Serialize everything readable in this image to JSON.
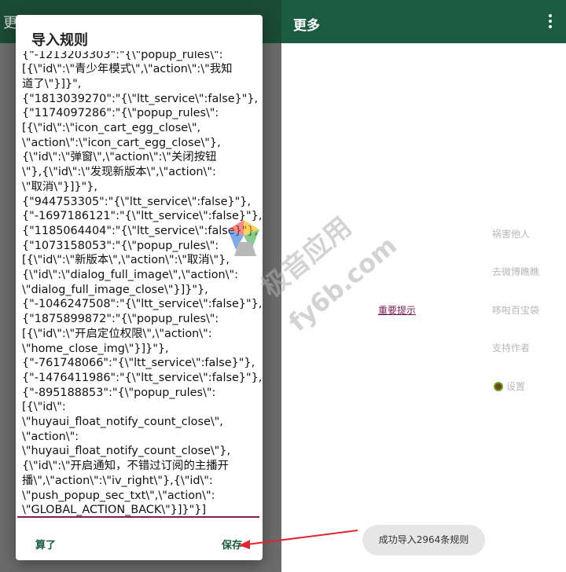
{
  "left_screen": {
    "title_ghost": "更"
  },
  "dialog": {
    "title": "导入规则",
    "rules_text": [
      "{\"-1213203303\":\"{\\\"popup_rules\\\":",
      "[{\\\"id\\\":\\\"青少年模式\\\",\\\"action\\\":\\\"我知",
      "道了\\\"}]}\",",
      "{\"1813039270\":\"{\\\"ltt_service\\\":false}\"},",
      "{\"1174097286\":\"{\\\"popup_rules\\\":",
      "[{\\\"id\\\":\\\"icon_cart_egg_close\\\",",
      "\\\"action\\\":\\\"icon_cart_egg_close\\\"},",
      "{\\\"id\\\":\\\"弹窗\\\",\\\"action\\\":\\\"关闭按钮",
      "\\\"},{\\\"id\\\":\\\"发现新版本\\\",\\\"action\\\":",
      "\\\"取消\\\"}]}\"},",
      "{\"944753305\":\"{\\\"ltt_service\\\":false}\"},",
      "{\"-1697186121\":\"{\\\"ltt_service\\\":false}\"},",
      "{\"1185064404\":\"{\\\"ltt_service\\\":false}\"},",
      "{\"1073158053\":\"{\\\"popup_rules\\\":",
      "[{\\\"id\\\":\\\"新版本\\\",\\\"action\\\":\\\"取消\\\"},",
      "{\\\"id\\\":\\\"dialog_full_image\\\",\\\"action\\\":",
      "\\\"dialog_full_image_close\\\"}]}\"},",
      "{\"-1046247508\":\"{\\\"ltt_service\\\":false}\"},",
      "{\"1875899872\":\"{\\\"popup_rules\\\":",
      "[{\\\"id\\\":\\\"开启定位权限\\\",\\\"action\\\":",
      "\\\"home_close_img\\\"}]}\"},",
      "{\"-761748066\":\"{\\\"ltt_service\\\":false}\"},",
      "{\"-1476411986\":\"{\\\"ltt_service\\\":false}\"},",
      "{\"-895188853\":\"{\\\"popup_rules\\\":",
      "[{\\\"id\\\":",
      "\\\"huyaui_float_notify_count_close\\\",",
      "\\\"action\\\":",
      "\\\"huyaui_float_notify_count_close\\\"},",
      "{\\\"id\\\":\\\"开启通知，不错过订阅的主播开",
      "播\\\",\\\"action\\\":\\\"iv_right\\\"},{\\\"id\\\":",
      "\\\"push_popup_sec_txt\\\",\\\"action\\\":",
      "\\\"GLOBAL_ACTION_BACK\\\"}]}\"}]"
    ],
    "cancel_label": "算了",
    "save_label": "保存"
  },
  "right_screen": {
    "title": "更多",
    "menu_items": [
      "祸害他人",
      "去微博瞧瞧",
      "哆啦百宝袋",
      "支持作者"
    ],
    "important_link": "重要提示",
    "settings_label": "设置",
    "toast": "成功导入2964条规则"
  },
  "watermark": {
    "line1": "极音应用",
    "line2": "fy6b.com"
  },
  "colors": {
    "toolbar": "#1b5b42",
    "accent_button": "#1d5a3e",
    "underline": "#7e1e5a",
    "arrow": "#e0262d"
  }
}
